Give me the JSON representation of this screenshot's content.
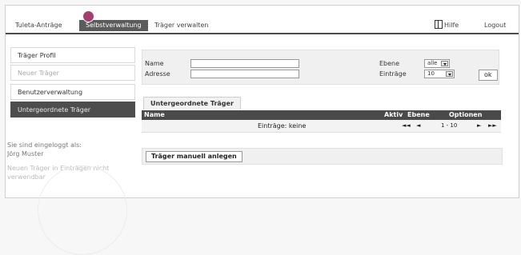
{
  "nav": {
    "tabs": [
      {
        "label": "Tuleta-Anträge",
        "active": false
      },
      {
        "label": "Selbstverwaltung",
        "active": true
      },
      {
        "label": "Träger verwalten",
        "active": false
      }
    ],
    "help_label": "Hilfe",
    "logout_label": "Logout"
  },
  "sidebar": {
    "items": [
      {
        "label": "Träger Profil",
        "state": "normal"
      },
      {
        "label": "Neuer Träger",
        "state": "muted"
      },
      {
        "label": "Benutzerverwaltung",
        "state": "normal"
      },
      {
        "label": "Untergeordnete Träger",
        "state": "active"
      }
    ],
    "login_info_line1": "Sie sind eingeloggt als:",
    "login_info_line2": "Jörg Muster",
    "note_line1": "Neuen Träger in Einträgen nicht",
    "note_line2": "verwendbar"
  },
  "filter": {
    "name_label": "Name",
    "name_value": "",
    "address_label": "Adresse",
    "address_value": "",
    "level_label": "Ebene",
    "level_value": "alle",
    "entries_label": "Einträge",
    "entries_value": "10",
    "ok_label": "ok"
  },
  "results": {
    "tab_label": "Untergeordnete Träger",
    "columns": {
      "name": "Name",
      "active": "Aktiv",
      "level": "Ebene",
      "options": "Optionen"
    },
    "entries_text": "Einträge: keine",
    "pager": {
      "first": "◄◄",
      "prev": "◄",
      "range": "1 - 10",
      "next": "►",
      "last": "►►"
    }
  },
  "add_button_label": "Träger manuell anlegen",
  "colors": {
    "accent": "#4a4a4a",
    "badge": "#a23f6e"
  }
}
